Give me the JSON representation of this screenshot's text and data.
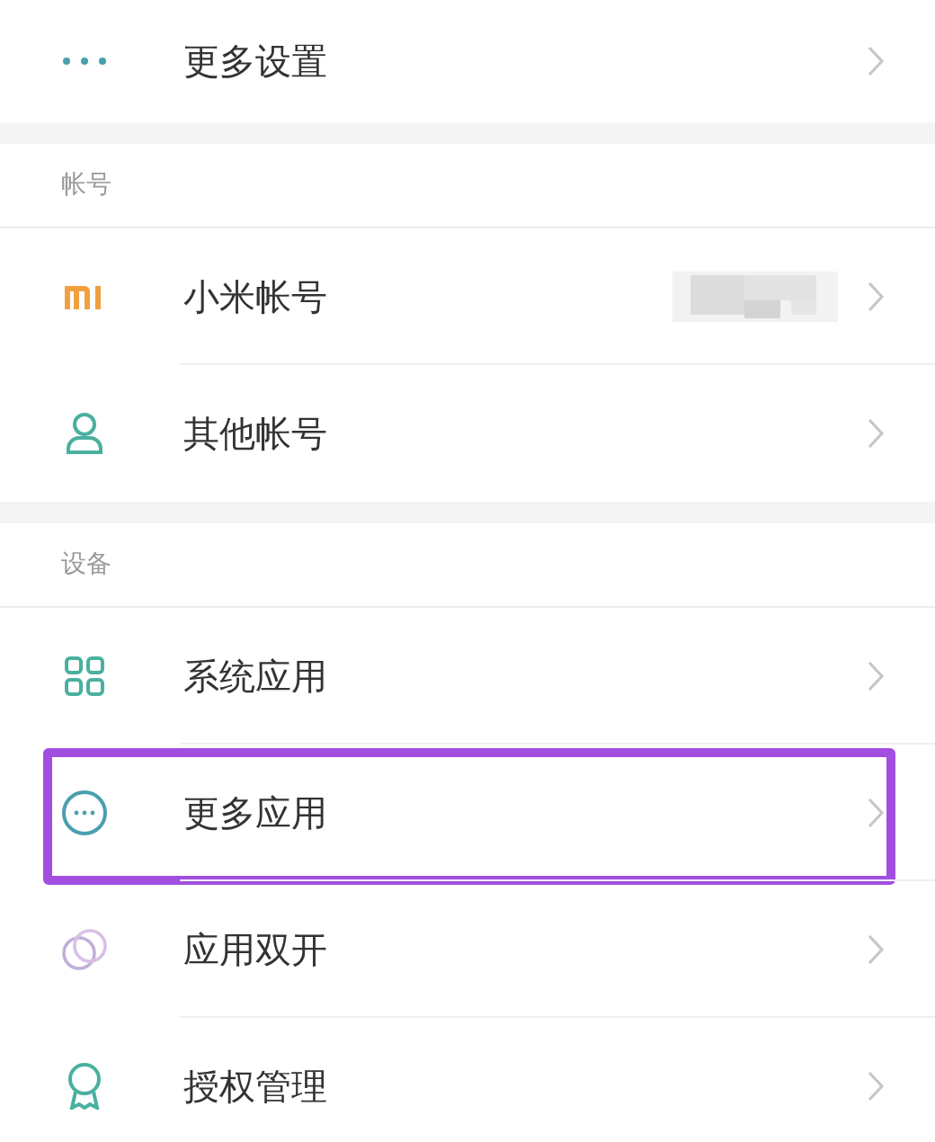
{
  "groups": [
    {
      "items": [
        {
          "kind": "dots",
          "label": "更多设置"
        }
      ]
    },
    {
      "title": "帐号",
      "items": [
        {
          "kind": "mi",
          "label": "小米帐号",
          "value_blurred": true
        },
        {
          "kind": "person",
          "label": "其他帐号"
        }
      ]
    },
    {
      "title": "设备",
      "items": [
        {
          "kind": "grid",
          "label": "系统应用"
        },
        {
          "kind": "dots-circle",
          "label": "更多应用",
          "highlighted": true
        },
        {
          "kind": "rings",
          "label": "应用双开"
        },
        {
          "kind": "badge",
          "label": "授权管理"
        }
      ]
    }
  ]
}
